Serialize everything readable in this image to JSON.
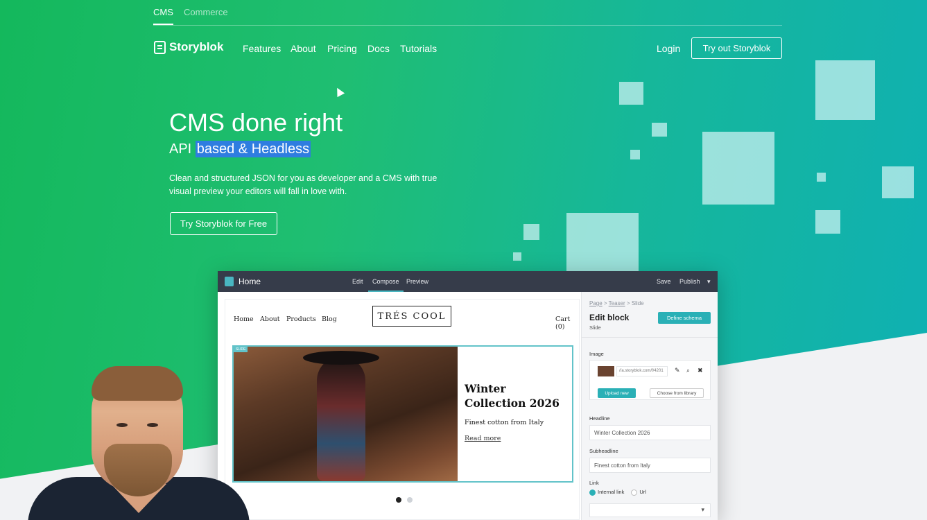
{
  "top_tabs": [
    "CMS",
    "Commerce"
  ],
  "brand": "Storyblok",
  "nav": [
    "Features",
    "About",
    "Pricing",
    "Docs",
    "Tutorials"
  ],
  "login": "Login",
  "cta_top": "Try out Storyblok",
  "hero": {
    "title": "CMS done right",
    "subtitle_prefix": "API ",
    "subtitle_selected": "based & Headless",
    "description": "Clean and structured JSON for you as developer and a CMS with true visual preview your editors will fall in love with.",
    "button": "Try Storyblok for Free"
  },
  "app": {
    "home": "Home",
    "modes": [
      "Edit",
      "Compose",
      "Preview"
    ],
    "actions": [
      "Save",
      "Publish"
    ],
    "preview": {
      "links": [
        "Home",
        "About",
        "Products",
        "Blog"
      ],
      "brand": "TRÉS COOL",
      "cart": "Cart (0)",
      "slide_tag": "SLIDE",
      "slide_title": "Winter Collection 2026",
      "slide_text": "Finest cotton from Italy",
      "slide_link": "Read more"
    },
    "panel": {
      "crumbs": [
        "Page",
        "Teaser",
        "Slide"
      ],
      "title": "Edit block",
      "subtitle": "Slide",
      "define_schema": "Define schema",
      "image_label": "Image",
      "image_url": "//a.storyblok.com/f/4201",
      "upload": "Upload new",
      "library": "Choose from library",
      "headline_label": "Headline",
      "headline_value": "Winter Collection 2026",
      "subheadline_label": "Subheadline",
      "subheadline_value": "Finest cotton from Italy",
      "link_label": "Link",
      "link_options": [
        "Internal link",
        "Url"
      ]
    }
  },
  "colors": {
    "gradient_start": "#14b85c",
    "gradient_end": "#0fb0b4",
    "accent": "#2ab0b6",
    "selection": "#2f7de0"
  }
}
